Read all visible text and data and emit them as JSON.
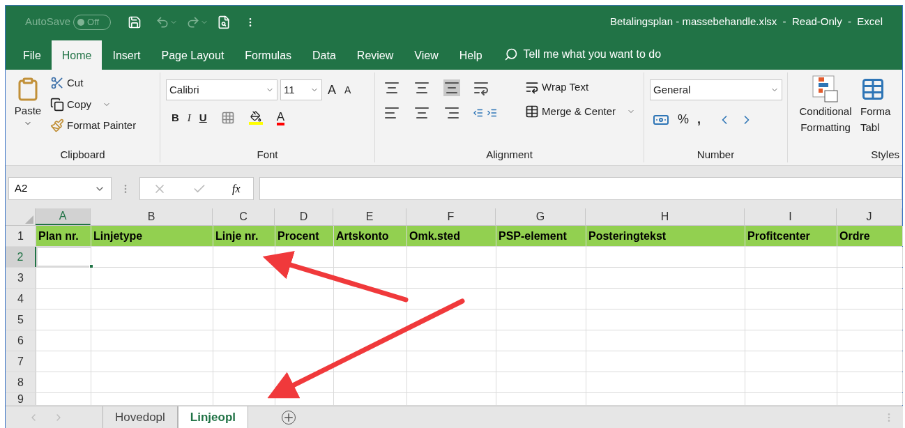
{
  "title_bar": {
    "autosave": {
      "label": "AutoSave",
      "state": "Off",
      "on": false
    },
    "title": "Betalingsplan - massebehandle.xlsx  -  Read-Only  -  Excel"
  },
  "menu_tabs": [
    {
      "label": "File",
      "selected": false
    },
    {
      "label": "Home",
      "selected": true
    },
    {
      "label": "Insert",
      "selected": false
    },
    {
      "label": "Page Layout",
      "selected": false
    },
    {
      "label": "Formulas",
      "selected": false
    },
    {
      "label": "Data",
      "selected": false
    },
    {
      "label": "Review",
      "selected": false
    },
    {
      "label": "View",
      "selected": false
    },
    {
      "label": "Help",
      "selected": false
    }
  ],
  "tell_me": {
    "placeholder": "Tell me what you want to do"
  },
  "ribbon": {
    "clipboard": {
      "paste": "Paste",
      "cut": "Cut",
      "copy": "Copy",
      "format_painter": "Format Painter",
      "label": "Clipboard"
    },
    "font": {
      "font_name": "Calibri",
      "font_size": "11",
      "grow": "A",
      "shrink": "A",
      "bold": "B",
      "italic": "I",
      "underline": "U",
      "font_color": "A",
      "label": "Font"
    },
    "alignment": {
      "wrap_text": "Wrap Text",
      "merge_center": "Merge & Center",
      "label": "Alignment"
    },
    "number": {
      "format": "General",
      "percent": "%",
      "comma": ",",
      "label": "Number"
    },
    "styles": {
      "conditional_formatting": "Conditional Formatting",
      "format_as_table": [
        "Forma",
        "Tabl"
      ],
      "label": "Styles"
    }
  },
  "formula_bar": {
    "name_box": "A2",
    "fx": "fx"
  },
  "columns": [
    {
      "letter": "A",
      "selected": true
    },
    {
      "letter": "B",
      "selected": false
    },
    {
      "letter": "C",
      "selected": false
    },
    {
      "letter": "D",
      "selected": false
    },
    {
      "letter": "E",
      "selected": false
    },
    {
      "letter": "F",
      "selected": false
    },
    {
      "letter": "G",
      "selected": false
    },
    {
      "letter": "H",
      "selected": false
    },
    {
      "letter": "I",
      "selected": false
    },
    {
      "letter": "J",
      "selected": false
    }
  ],
  "rows": [
    {
      "number": "1",
      "selected": false,
      "cells": [
        "Plan nr.",
        "Linjetype",
        "Linje nr.",
        "Procent",
        "Artskonto",
        "Omk.sted",
        "PSP-element",
        "Posteringtekst",
        "Profitcenter",
        "Ordre"
      ]
    },
    {
      "number": "2",
      "selected": true,
      "cells": []
    },
    {
      "number": "3",
      "selected": false,
      "cells": []
    },
    {
      "number": "4",
      "selected": false,
      "cells": []
    },
    {
      "number": "5",
      "selected": false,
      "cells": []
    },
    {
      "number": "6",
      "selected": false,
      "cells": []
    },
    {
      "number": "7",
      "selected": false,
      "cells": []
    },
    {
      "number": "8",
      "selected": false,
      "cells": []
    },
    {
      "number": "9",
      "selected": false,
      "cells": []
    }
  ],
  "sheet_tabs": [
    {
      "label": "Hovedopl",
      "selected": false
    },
    {
      "label": "Linjeopl",
      "selected": true
    }
  ]
}
